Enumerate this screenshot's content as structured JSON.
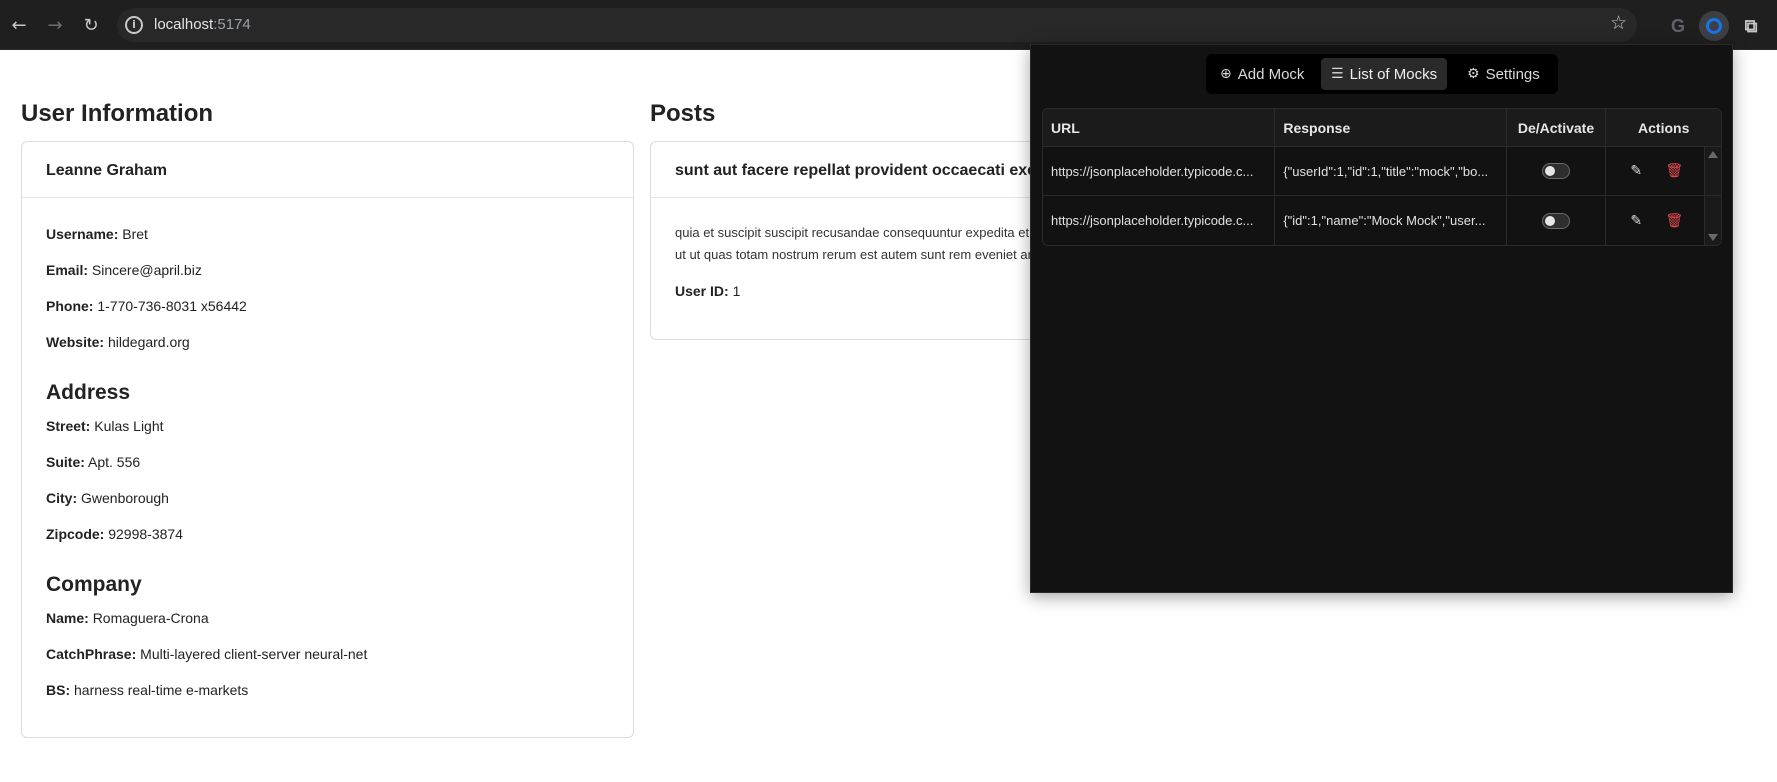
{
  "browser": {
    "url_host": "localhost",
    "url_port": ":5174",
    "icons": {
      "back": "back-arrow-icon",
      "forward": "forward-arrow-icon",
      "reload": "reload-icon",
      "info": "site-info-icon",
      "star": "bookmark-star-icon",
      "google": "google-icon",
      "extension": "mock-extension-icon",
      "puzzle": "extensions-puzzle-icon"
    }
  },
  "user_info": {
    "section_title": "User Information",
    "name": "Leanne Graham",
    "username_label": "Username:",
    "username": "Bret",
    "email_label": "Email:",
    "email": "Sincere@april.biz",
    "phone_label": "Phone:",
    "phone": "1-770-736-8031 x56442",
    "website_label": "Website:",
    "website": "hildegard.org",
    "address": {
      "heading": "Address",
      "street_label": "Street:",
      "street": "Kulas Light",
      "suite_label": "Suite:",
      "suite": "Apt. 556",
      "city_label": "City:",
      "city": "Gwenborough",
      "zipcode_label": "Zipcode:",
      "zipcode": "92998-3874"
    },
    "company": {
      "heading": "Company",
      "name_label": "Name:",
      "name": "Romaguera-Crona",
      "catchphrase_label": "CatchPhrase:",
      "catchphrase": "Multi-layered client-server neural-net",
      "bs_label": "BS:",
      "bs": "harness real-time e-markets"
    }
  },
  "posts": {
    "section_title": "Posts",
    "post_title": "sunt aut facere repellat provident occaecati excepturi optio reprehenderit",
    "body_line1": "quia et suscipit suscipit recusandae consequuntur expedita et cum",
    "body_line2": "ut ut quas totam nostrum rerum est autem sunt rem eveniet architecto",
    "user_id_label": "User ID:",
    "user_id": "1"
  },
  "popup": {
    "tabs": [
      {
        "label": "Add Mock",
        "icon": "plus-circle-icon",
        "active": false
      },
      {
        "label": "List of Mocks",
        "icon": "list-icon",
        "active": true
      },
      {
        "label": "Settings",
        "icon": "gear-icon",
        "active": false
      }
    ],
    "columns": [
      "URL",
      "Response",
      "De/Activate",
      "Actions"
    ],
    "rows": [
      {
        "url": "https://jsonplaceholder.typicode.c...",
        "response": "{\"userId\":1,\"id\":1,\"title\":\"mock\",\"bo...",
        "active": false
      },
      {
        "url": "https://jsonplaceholder.typicode.c...",
        "response": "{\"id\":1,\"name\":\"Mock Mock\",\"user...",
        "active": false
      }
    ],
    "colors": {
      "delete": "#e5484d",
      "background": "#121212"
    }
  }
}
